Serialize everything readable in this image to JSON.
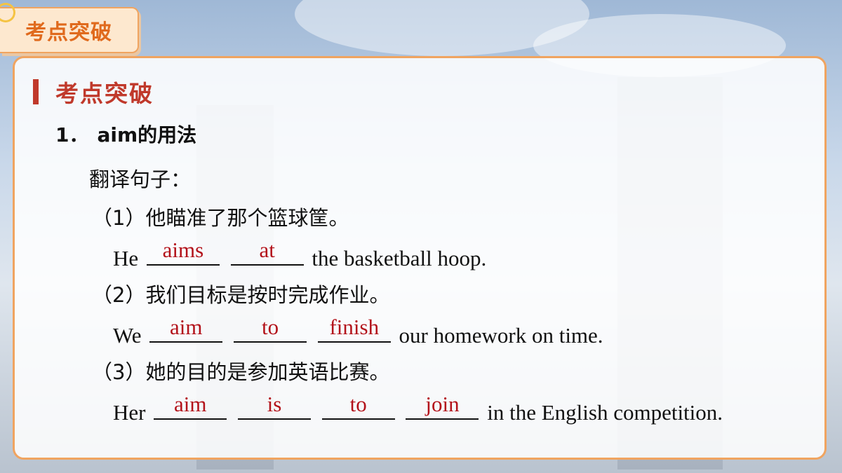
{
  "tab": {
    "label": "考点突破"
  },
  "section": {
    "title": "考点突破"
  },
  "heading": {
    "number": "1．",
    "text": "aim的用法"
  },
  "instruction": "翻译句子：",
  "items": [
    {
      "cn": "（1）他瞄准了那个篮球筐。",
      "en_before": "He",
      "answers": [
        "aims",
        "at"
      ],
      "en_after": "the basketball hoop."
    },
    {
      "cn": "（2）我们目标是按时完成作业。",
      "en_before": "We",
      "answers": [
        "aim",
        "to",
        "finish"
      ],
      "en_after": "our homework on time."
    },
    {
      "cn": "（3）她的目的是参加英语比赛。",
      "en_before": "Her",
      "answers": [
        "aim",
        "is",
        "to",
        "join"
      ],
      "en_after": "in the English competition."
    }
  ],
  "colors": {
    "accent": "#c0392b",
    "answer": "#b3121a",
    "frame": "#f0a460"
  }
}
